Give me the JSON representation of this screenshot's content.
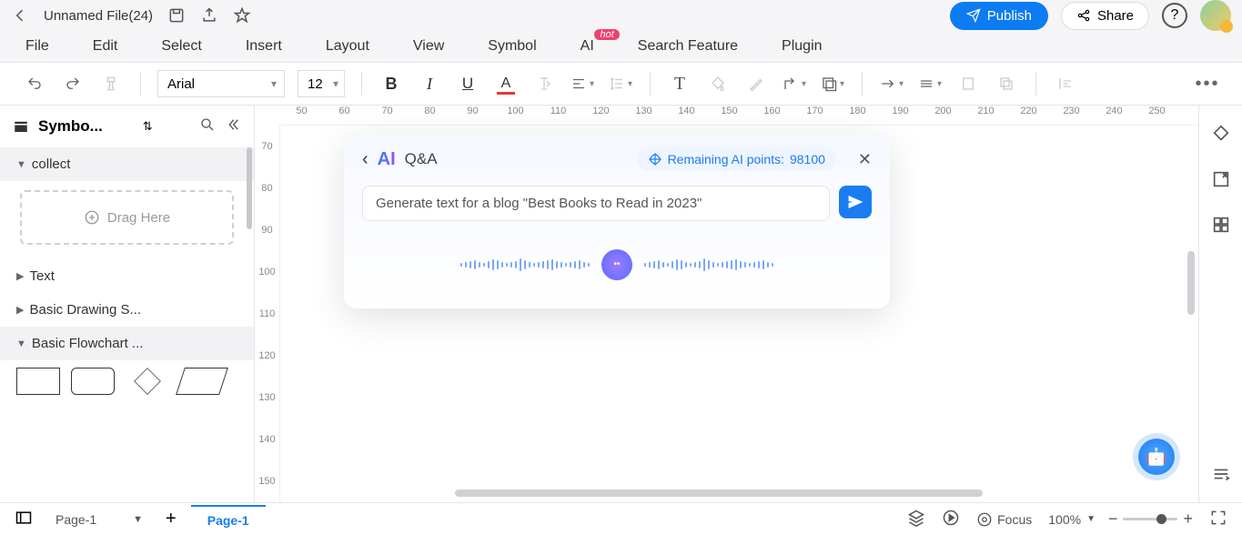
{
  "header": {
    "file_title": "Unnamed File(24)",
    "publish": "Publish",
    "share": "Share"
  },
  "menu": {
    "file": "File",
    "edit": "Edit",
    "select": "Select",
    "insert": "Insert",
    "layout": "Layout",
    "view": "View",
    "symbol": "Symbol",
    "ai": "AI",
    "ai_badge": "hot",
    "search": "Search Feature",
    "plugin": "Plugin"
  },
  "toolbar": {
    "font": "Arial",
    "size": "12"
  },
  "sidebar": {
    "title": "Symbo...",
    "collect": "collect",
    "drag": "Drag Here",
    "text": "Text",
    "basic_drawing": "Basic Drawing S...",
    "basic_flowchart": "Basic Flowchart ..."
  },
  "ruler_h": [
    "50",
    "60",
    "70",
    "80",
    "90",
    "100",
    "110",
    "120",
    "130",
    "140",
    "150",
    "160",
    "170",
    "180",
    "190",
    "200",
    "210",
    "220",
    "230",
    "240",
    "250"
  ],
  "ruler_v": [
    "70",
    "80",
    "90",
    "100",
    "110",
    "120",
    "130",
    "140",
    "150"
  ],
  "ai_panel": {
    "logo": "AI",
    "qa": "Q&A",
    "points_label": "Remaining AI points: ",
    "points_value": "98100",
    "prompt": "Generate text for a blog \"Best Books to Read in 2023\""
  },
  "bottom": {
    "page_dd": "Page-1",
    "active_tab": "Page-1",
    "focus": "Focus",
    "zoom": "100%"
  }
}
